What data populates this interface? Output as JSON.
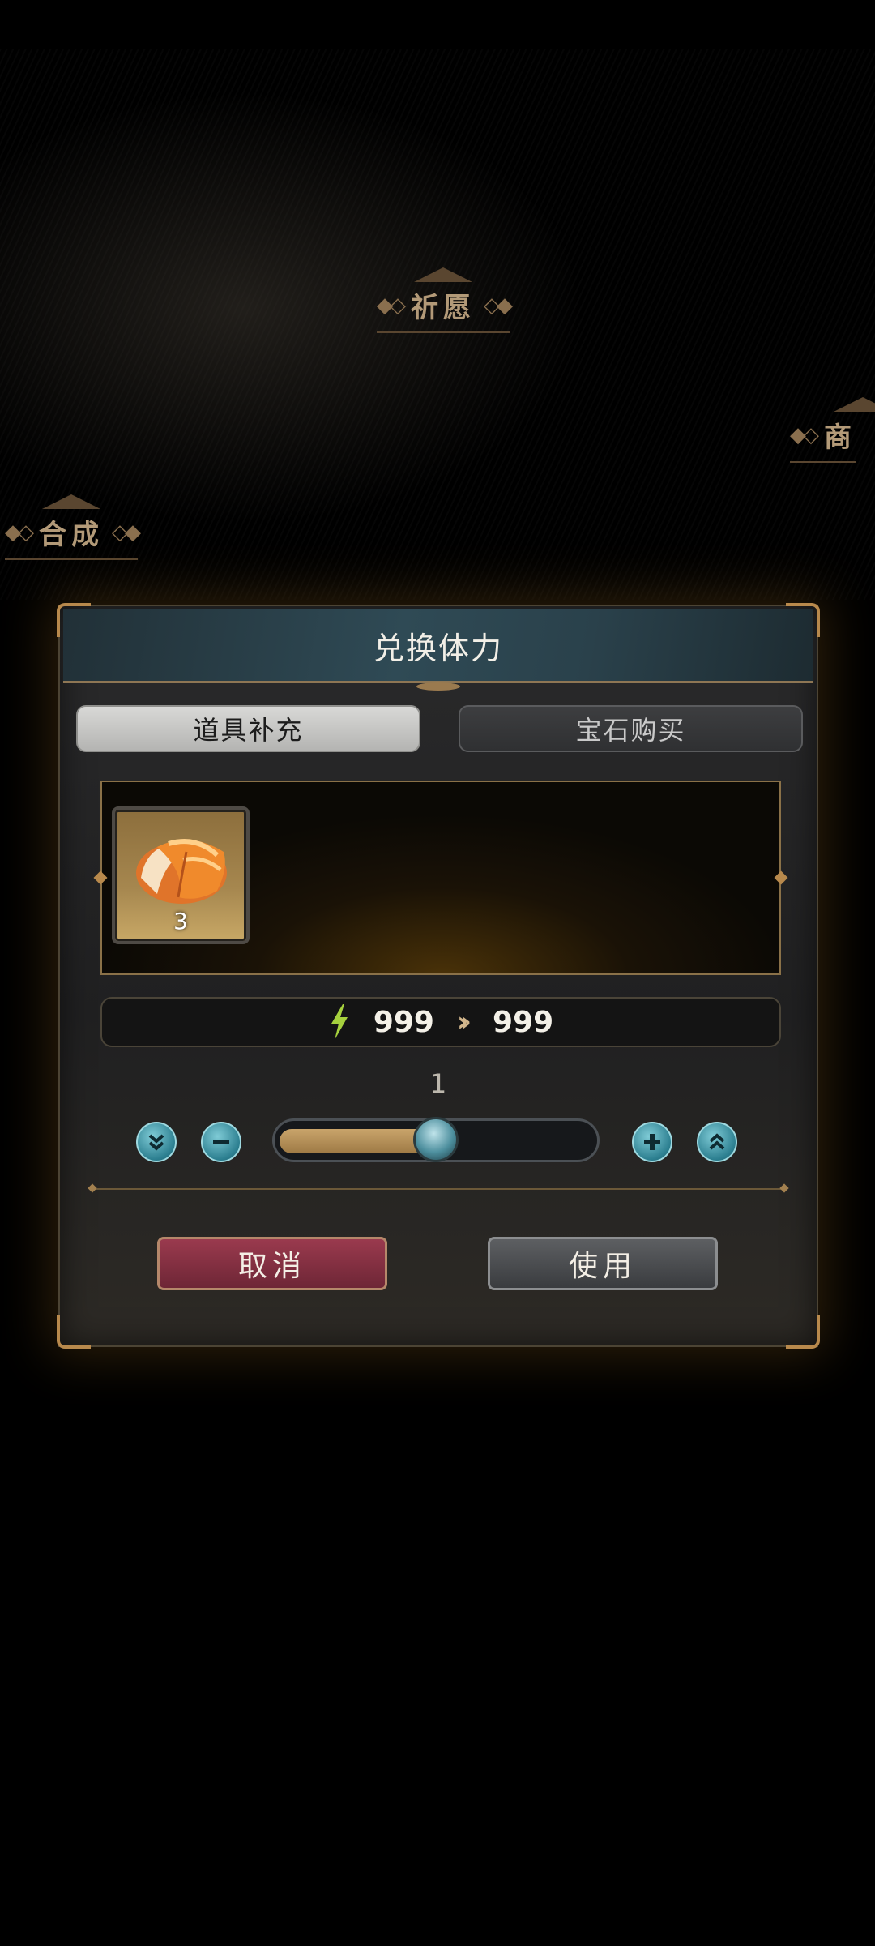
{
  "background": {
    "labels": [
      "祈愿",
      "商",
      "合成"
    ]
  },
  "dialog": {
    "title": "兑换体力",
    "tabs": [
      {
        "label": "道具补充",
        "active": true
      },
      {
        "label": "宝石购买",
        "active": false
      }
    ],
    "item": {
      "icon": "bread-icon",
      "count": "3"
    },
    "stamina": {
      "icon": "lightning-bolt-icon",
      "current": "999",
      "after": "999"
    },
    "quantity": {
      "value": "1",
      "fill_fraction": 0.5
    },
    "buttons": {
      "cancel": "取消",
      "use": "使用"
    }
  },
  "colors": {
    "accent_gold": "#b8894c",
    "cancel_red": "#9a3a4e",
    "control_teal": "#2c7f90"
  }
}
